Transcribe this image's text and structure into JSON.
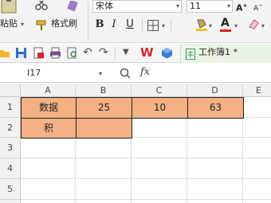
{
  "ribbon": {
    "paste_label": "粘贴",
    "format_painter_label": "格式刷",
    "font_name": "宋体",
    "font_size": "11",
    "bold": "B",
    "italic": "I",
    "underline": "U",
    "font_color_letter": "A"
  },
  "tab": {
    "title": "工作簿1 *"
  },
  "name_box": "I17",
  "fx": "fx",
  "columns": [
    "A",
    "B",
    "C",
    "D",
    "E"
  ],
  "rows": [
    "1",
    "2",
    "3",
    "4",
    "5"
  ],
  "cells": {
    "A1": "数据",
    "B1": "25",
    "C1": "10",
    "D1": "63",
    "A2": "积",
    "B2": ""
  },
  "colors": {
    "fill": "#f4b183",
    "tab_bg": "#eaf4e6",
    "wps_red": "#d9262c",
    "accent_blue": "#3a7bd5"
  }
}
